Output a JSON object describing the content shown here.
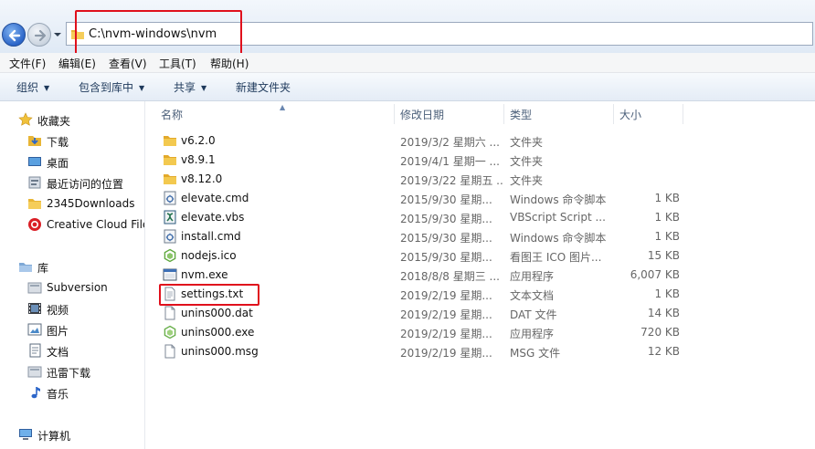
{
  "address": {
    "path": "C:\\nvm-windows\\nvm"
  },
  "chrome_top": {
    "left_text": "",
    "right_text": ""
  },
  "menu": [
    "文件(F)",
    "编辑(E)",
    "查看(V)",
    "工具(T)",
    "帮助(H)"
  ],
  "toolbar": {
    "organize": "组织",
    "include_library": "包含到库中",
    "share": "共享",
    "new_folder": "新建文件夹"
  },
  "nav": {
    "favorites": "收藏夹",
    "downloads": "下载",
    "desktop": "桌面",
    "recent": "最近访问的位置",
    "downloads2345": "2345Downloads",
    "creative_cloud": "Creative Cloud Files",
    "libraries": "库",
    "subversion": "Subversion",
    "videos": "视频",
    "pictures": "图片",
    "documents": "文档",
    "xunlei": "迅雷下载",
    "music": "音乐",
    "computer": "计算机"
  },
  "columns": {
    "name": "名称",
    "modified": "修改日期",
    "type": "类型",
    "size": "大小"
  },
  "files": [
    {
      "name": "v6.2.0",
      "date": "2019/3/2 星期六 ...",
      "type": "文件夹",
      "size": "",
      "icon": "folder-icon"
    },
    {
      "name": "v8.9.1",
      "date": "2019/4/1 星期一 ...",
      "type": "文件夹",
      "size": "",
      "icon": "folder-icon"
    },
    {
      "name": "v8.12.0",
      "date": "2019/3/22 星期五 ...",
      "type": "文件夹",
      "size": "",
      "icon": "folder-icon"
    },
    {
      "name": "elevate.cmd",
      "date": "2015/9/30 星期...",
      "type": "Windows 命令脚本",
      "size": "1 KB",
      "icon": "cmd-script-icon"
    },
    {
      "name": "elevate.vbs",
      "date": "2015/9/30 星期...",
      "type": "VBScript Script ...",
      "size": "1 KB",
      "icon": "vbs-script-icon"
    },
    {
      "name": "install.cmd",
      "date": "2015/9/30 星期...",
      "type": "Windows 命令脚本",
      "size": "1 KB",
      "icon": "cmd-script-icon"
    },
    {
      "name": "nodejs.ico",
      "date": "2015/9/30 星期...",
      "type": "看图王 ICO 图片...",
      "size": "15 KB",
      "icon": "image-file-icon"
    },
    {
      "name": "nvm.exe",
      "date": "2018/8/8 星期三 ...",
      "type": "应用程序",
      "size": "6,007 KB",
      "icon": "application-icon"
    },
    {
      "name": "settings.txt",
      "date": "2019/2/19 星期...",
      "type": "文本文档",
      "size": "1 KB",
      "icon": "text-file-icon"
    },
    {
      "name": "unins000.dat",
      "date": "2019/2/19 星期...",
      "type": "DAT 文件",
      "size": "14 KB",
      "icon": "blank-file-icon"
    },
    {
      "name": "unins000.exe",
      "date": "2019/2/19 星期...",
      "type": "应用程序",
      "size": "720 KB",
      "icon": "installer-icon"
    },
    {
      "name": "unins000.msg",
      "date": "2019/2/19 星期...",
      "type": "MSG 文件",
      "size": "12 KB",
      "icon": "blank-file-icon"
    }
  ],
  "colors": {
    "highlight_box": "#e0101c",
    "folder": "#e8b535",
    "toolbar_text": "#1e395b",
    "muted_text": "#666666"
  }
}
